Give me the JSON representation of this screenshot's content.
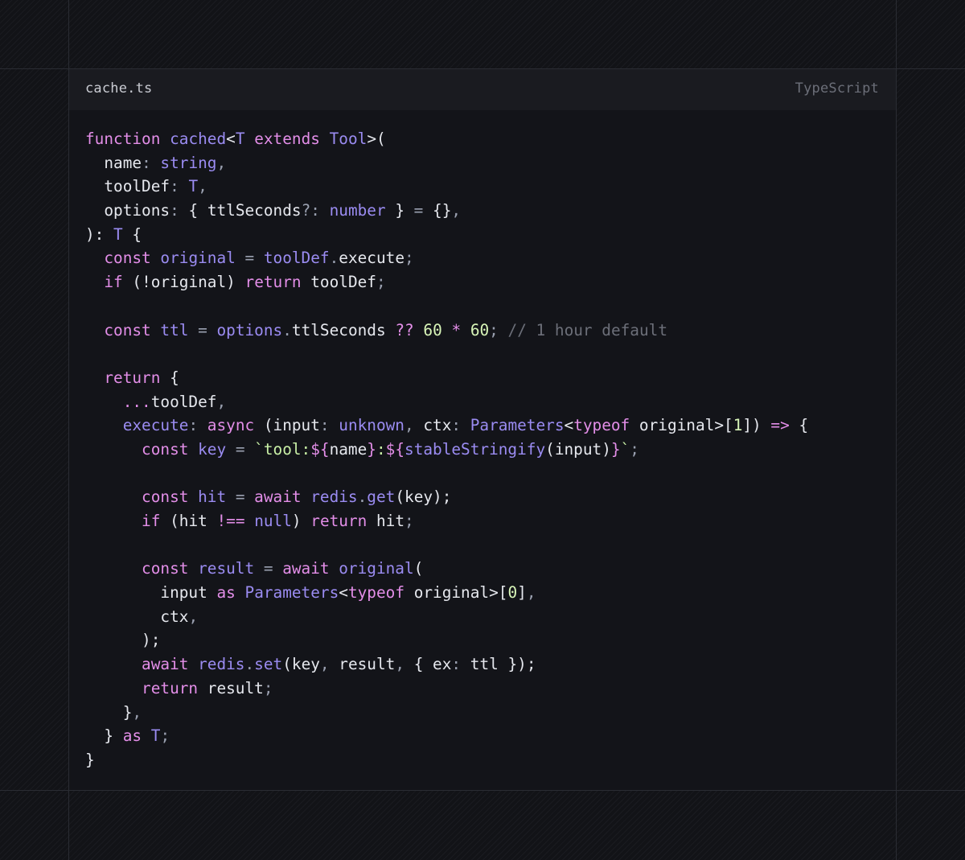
{
  "editor": {
    "file_name": "cache.ts",
    "language": "TypeScript",
    "lines": [
      [
        {
          "t": "function",
          "k": "kw"
        },
        {
          "t": " "
        },
        {
          "t": "cached",
          "k": "fn"
        },
        {
          "t": "<",
          "k": "brk"
        },
        {
          "t": "T",
          "k": "type"
        },
        {
          "t": " "
        },
        {
          "t": "extends",
          "k": "kw"
        },
        {
          "t": " "
        },
        {
          "t": "Tool",
          "k": "type"
        },
        {
          "t": ">(",
          "k": "brk"
        }
      ],
      [
        {
          "t": "  "
        },
        {
          "t": "name",
          "k": "var"
        },
        {
          "t": ": ",
          "k": "punc"
        },
        {
          "t": "string",
          "k": "type"
        },
        {
          "t": ",",
          "k": "punc"
        }
      ],
      [
        {
          "t": "  "
        },
        {
          "t": "toolDef",
          "k": "var"
        },
        {
          "t": ": ",
          "k": "punc"
        },
        {
          "t": "T",
          "k": "type"
        },
        {
          "t": ",",
          "k": "punc"
        }
      ],
      [
        {
          "t": "  "
        },
        {
          "t": "options",
          "k": "var"
        },
        {
          "t": ": ",
          "k": "punc"
        },
        {
          "t": "{ ",
          "k": "brk"
        },
        {
          "t": "ttlSeconds",
          "k": "var"
        },
        {
          "t": "?: ",
          "k": "punc"
        },
        {
          "t": "number",
          "k": "type"
        },
        {
          "t": " } ",
          "k": "brk"
        },
        {
          "t": "= ",
          "k": "punc"
        },
        {
          "t": "{}",
          "k": "brk"
        },
        {
          "t": ",",
          "k": "punc"
        }
      ],
      [
        {
          "t": "): ",
          "k": "brk"
        },
        {
          "t": "T",
          "k": "type"
        },
        {
          "t": " {",
          "k": "brk"
        }
      ],
      [
        {
          "t": "  "
        },
        {
          "t": "const",
          "k": "kw"
        },
        {
          "t": " "
        },
        {
          "t": "original",
          "k": "fn"
        },
        {
          "t": " = ",
          "k": "punc"
        },
        {
          "t": "toolDef",
          "k": "fn"
        },
        {
          "t": ".",
          "k": "punc"
        },
        {
          "t": "execute",
          "k": "var"
        },
        {
          "t": ";",
          "k": "punc"
        }
      ],
      [
        {
          "t": "  "
        },
        {
          "t": "if",
          "k": "kw"
        },
        {
          "t": " (!",
          "k": "brk"
        },
        {
          "t": "original",
          "k": "var"
        },
        {
          "t": ") ",
          "k": "brk"
        },
        {
          "t": "return",
          "k": "kw"
        },
        {
          "t": " "
        },
        {
          "t": "toolDef",
          "k": "var"
        },
        {
          "t": ";",
          "k": "punc"
        }
      ],
      [],
      [
        {
          "t": "  "
        },
        {
          "t": "const",
          "k": "kw"
        },
        {
          "t": " "
        },
        {
          "t": "ttl",
          "k": "fn"
        },
        {
          "t": " = ",
          "k": "punc"
        },
        {
          "t": "options",
          "k": "fn"
        },
        {
          "t": ".",
          "k": "punc"
        },
        {
          "t": "ttlSeconds",
          "k": "var"
        },
        {
          "t": " "
        },
        {
          "t": "??",
          "k": "kw"
        },
        {
          "t": " "
        },
        {
          "t": "60",
          "k": "num"
        },
        {
          "t": " "
        },
        {
          "t": "*",
          "k": "kw"
        },
        {
          "t": " "
        },
        {
          "t": "60",
          "k": "num"
        },
        {
          "t": "; ",
          "k": "punc"
        },
        {
          "t": "// 1 hour default",
          "k": "cmt"
        }
      ],
      [],
      [
        {
          "t": "  "
        },
        {
          "t": "return",
          "k": "kw"
        },
        {
          "t": " {",
          "k": "brk"
        }
      ],
      [
        {
          "t": "    "
        },
        {
          "t": "...",
          "k": "kw"
        },
        {
          "t": "toolDef",
          "k": "var"
        },
        {
          "t": ",",
          "k": "punc"
        }
      ],
      [
        {
          "t": "    "
        },
        {
          "t": "execute",
          "k": "fn"
        },
        {
          "t": ": ",
          "k": "punc"
        },
        {
          "t": "async",
          "k": "kw"
        },
        {
          "t": " ("
        },
        {
          "t": "input",
          "k": "var"
        },
        {
          "t": ": ",
          "k": "punc"
        },
        {
          "t": "unknown",
          "k": "type"
        },
        {
          "t": ", ",
          "k": "punc"
        },
        {
          "t": "ctx",
          "k": "var"
        },
        {
          "t": ": ",
          "k": "punc"
        },
        {
          "t": "Parameters",
          "k": "type"
        },
        {
          "t": "<",
          "k": "brk"
        },
        {
          "t": "typeof",
          "k": "kw"
        },
        {
          "t": " "
        },
        {
          "t": "original",
          "k": "var"
        },
        {
          "t": ">[",
          "k": "brk"
        },
        {
          "t": "1",
          "k": "num"
        },
        {
          "t": "]) ",
          "k": "brk"
        },
        {
          "t": "=>",
          "k": "kw"
        },
        {
          "t": " {",
          "k": "brk"
        }
      ],
      [
        {
          "t": "      "
        },
        {
          "t": "const",
          "k": "kw"
        },
        {
          "t": " "
        },
        {
          "t": "key",
          "k": "fn"
        },
        {
          "t": " = ",
          "k": "punc"
        },
        {
          "t": "`tool:",
          "k": "str"
        },
        {
          "t": "${",
          "k": "kw"
        },
        {
          "t": "name",
          "k": "var"
        },
        {
          "t": "}",
          "k": "kw"
        },
        {
          "t": ":",
          "k": "str"
        },
        {
          "t": "${",
          "k": "kw"
        },
        {
          "t": "stableStringify",
          "k": "fn"
        },
        {
          "t": "(",
          "k": "brk"
        },
        {
          "t": "input",
          "k": "var"
        },
        {
          "t": ")",
          "k": "brk"
        },
        {
          "t": "}",
          "k": "kw"
        },
        {
          "t": "`",
          "k": "str"
        },
        {
          "t": ";",
          "k": "punc"
        }
      ],
      [],
      [
        {
          "t": "      "
        },
        {
          "t": "const",
          "k": "kw"
        },
        {
          "t": " "
        },
        {
          "t": "hit",
          "k": "fn"
        },
        {
          "t": " = ",
          "k": "punc"
        },
        {
          "t": "await",
          "k": "kw"
        },
        {
          "t": " "
        },
        {
          "t": "redis",
          "k": "fn"
        },
        {
          "t": ".",
          "k": "punc"
        },
        {
          "t": "get",
          "k": "fn"
        },
        {
          "t": "(",
          "k": "brk"
        },
        {
          "t": "key",
          "k": "var"
        },
        {
          "t": ");",
          "k": "brk"
        }
      ],
      [
        {
          "t": "      "
        },
        {
          "t": "if",
          "k": "kw"
        },
        {
          "t": " ("
        },
        {
          "t": "hit",
          "k": "var"
        },
        {
          "t": " "
        },
        {
          "t": "!==",
          "k": "kw"
        },
        {
          "t": " "
        },
        {
          "t": "null",
          "k": "fn"
        },
        {
          "t": ") ",
          "k": "brk"
        },
        {
          "t": "return",
          "k": "kw"
        },
        {
          "t": " "
        },
        {
          "t": "hit",
          "k": "var"
        },
        {
          "t": ";",
          "k": "punc"
        }
      ],
      [],
      [
        {
          "t": "      "
        },
        {
          "t": "const",
          "k": "kw"
        },
        {
          "t": " "
        },
        {
          "t": "result",
          "k": "fn"
        },
        {
          "t": " = ",
          "k": "punc"
        },
        {
          "t": "await",
          "k": "kw"
        },
        {
          "t": " "
        },
        {
          "t": "original",
          "k": "fn"
        },
        {
          "t": "(",
          "k": "brk"
        }
      ],
      [
        {
          "t": "        "
        },
        {
          "t": "input",
          "k": "var"
        },
        {
          "t": " "
        },
        {
          "t": "as",
          "k": "kw"
        },
        {
          "t": " "
        },
        {
          "t": "Parameters",
          "k": "type"
        },
        {
          "t": "<",
          "k": "brk"
        },
        {
          "t": "typeof",
          "k": "kw"
        },
        {
          "t": " "
        },
        {
          "t": "original",
          "k": "var"
        },
        {
          "t": ">[",
          "k": "brk"
        },
        {
          "t": "0",
          "k": "num"
        },
        {
          "t": "]",
          "k": "brk"
        },
        {
          "t": ",",
          "k": "punc"
        }
      ],
      [
        {
          "t": "        "
        },
        {
          "t": "ctx",
          "k": "var"
        },
        {
          "t": ",",
          "k": "punc"
        }
      ],
      [
        {
          "t": "      "
        },
        {
          "t": ");",
          "k": "brk"
        }
      ],
      [
        {
          "t": "      "
        },
        {
          "t": "await",
          "k": "kw"
        },
        {
          "t": " "
        },
        {
          "t": "redis",
          "k": "fn"
        },
        {
          "t": ".",
          "k": "punc"
        },
        {
          "t": "set",
          "k": "fn"
        },
        {
          "t": "(",
          "k": "brk"
        },
        {
          "t": "key",
          "k": "var"
        },
        {
          "t": ", ",
          "k": "punc"
        },
        {
          "t": "result",
          "k": "var"
        },
        {
          "t": ", ",
          "k": "punc"
        },
        {
          "t": "{ ",
          "k": "brk"
        },
        {
          "t": "ex",
          "k": "var"
        },
        {
          "t": ": ",
          "k": "punc"
        },
        {
          "t": "ttl",
          "k": "var"
        },
        {
          "t": " });",
          "k": "brk"
        }
      ],
      [
        {
          "t": "      "
        },
        {
          "t": "return",
          "k": "kw"
        },
        {
          "t": " "
        },
        {
          "t": "result",
          "k": "var"
        },
        {
          "t": ";",
          "k": "punc"
        }
      ],
      [
        {
          "t": "    "
        },
        {
          "t": "}",
          "k": "brk"
        },
        {
          "t": ",",
          "k": "punc"
        }
      ],
      [
        {
          "t": "  "
        },
        {
          "t": "} ",
          "k": "brk"
        },
        {
          "t": "as",
          "k": "kw"
        },
        {
          "t": " "
        },
        {
          "t": "T",
          "k": "type"
        },
        {
          "t": ";",
          "k": "punc"
        }
      ],
      [
        {
          "t": "}",
          "k": "brk"
        }
      ]
    ]
  }
}
